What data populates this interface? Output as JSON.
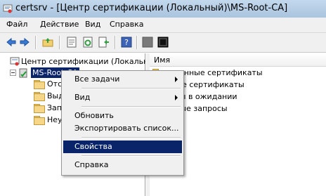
{
  "window": {
    "title": "certsrv - [Центр сертификации (Локальный)\\MS-Root-CA]"
  },
  "menu": [
    "Файл",
    "Действие",
    "Вид",
    "Справка"
  ],
  "toolbar": {
    "icons": [
      "back-icon",
      "forward-icon",
      "up-folder-icon",
      "properties-icon",
      "refresh-icon",
      "export-icon",
      "help-icon",
      "stop-service-icon",
      "start-service-icon"
    ]
  },
  "tree": {
    "root": "Центр сертификации (Локальный)",
    "ca": "MS-Root-CA",
    "children": [
      "Отс",
      "Выд",
      "Запр",
      "Неуд"
    ]
  },
  "list": {
    "column": "Имя",
    "items": [
      "озванные сертификаты",
      "нные сертификаты",
      "росы в ожидании",
      "ачные запросы"
    ]
  },
  "context_menu": {
    "items": [
      "Все задачи",
      "Вид",
      "Обновить",
      "Экспортировать список...",
      "Свойства",
      "Справка"
    ],
    "highlighted": "Свойства"
  },
  "colors": {
    "highlight": "#0a246a",
    "titlebar": "#b7cee6"
  }
}
